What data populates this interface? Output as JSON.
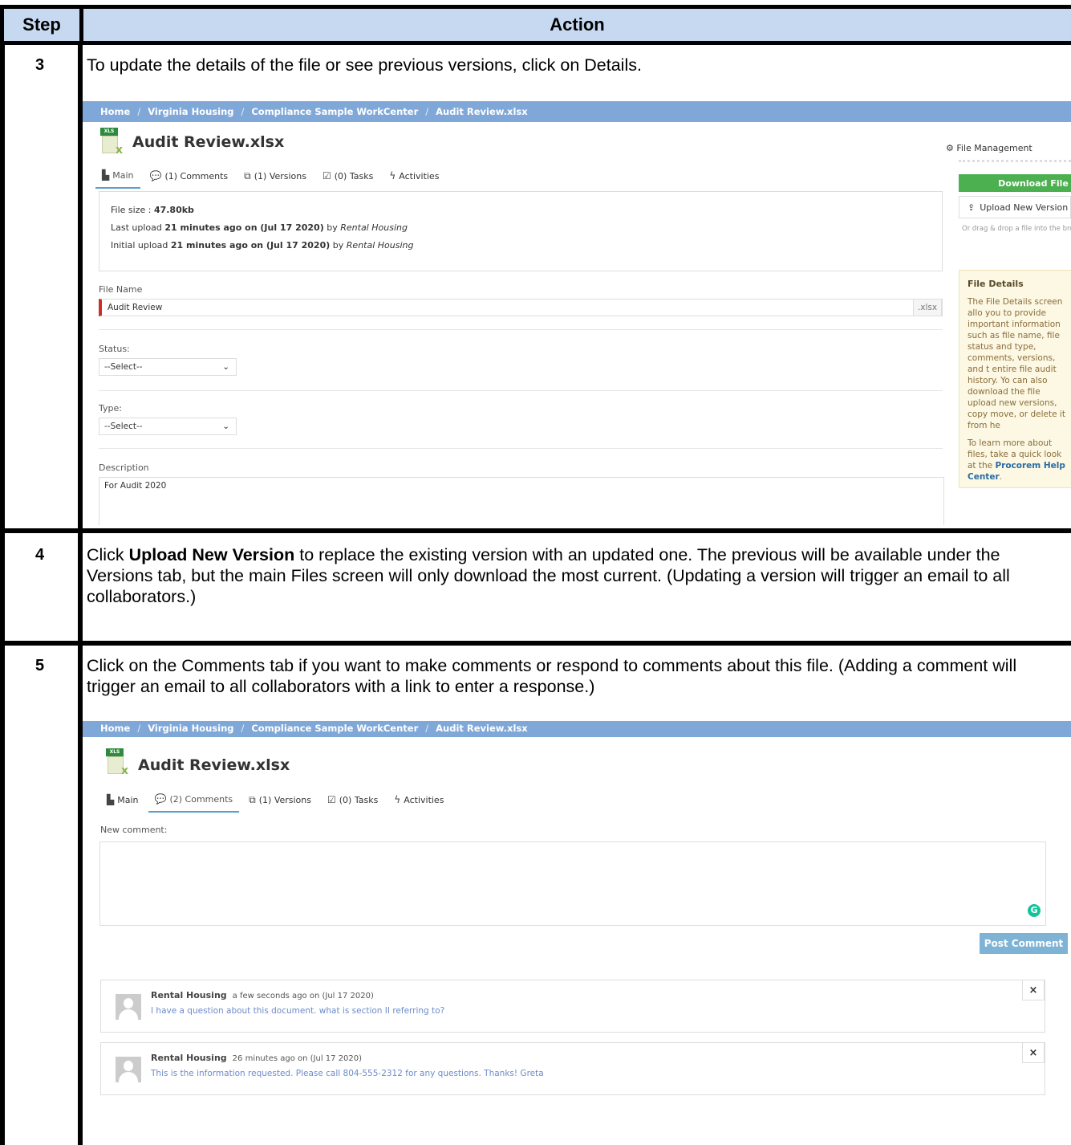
{
  "table": {
    "col_step": "Step",
    "col_action": "Action",
    "rows": [
      {
        "step": "3",
        "text": "To update the details of the file or see previous versions, click on Details."
      },
      {
        "step": "4",
        "text_before": "Click ",
        "text_bold": "Upload New Version",
        "text_after": " to replace the existing version with an updated one.  The previous will be available under the Versions tab, but the main Files screen will only download the most current. (Updating a version will trigger an email to all collaborators.)"
      },
      {
        "step": "5",
        "text": "Click on the Comments tab if you want to make comments or respond to comments about this file. (Adding a comment will trigger an email to all collaborators with a link to enter a response.)"
      }
    ]
  },
  "shot1": {
    "breadcrumb": [
      "Home",
      "Virginia Housing",
      "Compliance Sample WorkCenter",
      "Audit Review.xlsx"
    ],
    "breadcrumb_sep": "/",
    "icon_tag": "XLS",
    "title": "Audit Review.xlsx",
    "tabs": [
      "Main",
      "(1) Comments",
      "(1) Versions",
      "(0) Tasks",
      "Activities"
    ],
    "info": {
      "size_label": "File size : ",
      "size_value": "47.80kb",
      "last_prefix": "Last upload ",
      "last_bold": "21 minutes ago on (Jul 17 2020)",
      "last_by": " by ",
      "last_user": "Rental Housing",
      "init_prefix": "Initial upload ",
      "init_bold": "21 minutes ago on (Jul 17 2020)",
      "init_by": " by ",
      "init_user": "Rental Housing"
    },
    "file_name_label": "File Name",
    "file_name_value": "Audit Review",
    "file_ext": ".xlsx",
    "status_label": "Status:",
    "status_value": "--Select--",
    "type_label": "Type:",
    "type_value": "--Select--",
    "description_label": "Description",
    "description_value": "For Audit 2020",
    "side": {
      "heading": "File Management",
      "download": "Download File",
      "upload": "Upload New Version",
      "hint": "Or drag & drop a file into the brow",
      "details_title": "File Details",
      "details_p1": "The File Details screen allo you to provide important information such as file name, file status and type, comments, versions, and t entire file audit history. Yo can also download the file upload new versions, copy move, or delete it from he",
      "details_p2": "To learn more about files, take a quick look at the",
      "details_link": "Procorem Help Center",
      "details_end": "."
    }
  },
  "shot2": {
    "breadcrumb": [
      "Home",
      "Virginia Housing",
      "Compliance Sample WorkCenter",
      "Audit Review.xlsx"
    ],
    "breadcrumb_sep": "/",
    "icon_tag": "XLS",
    "title": "Audit Review.xlsx",
    "tabs": [
      "Main",
      "(2) Comments",
      "(1) Versions",
      "(0) Tasks",
      "Activities"
    ],
    "new_comment_label": "New comment:",
    "grammarly": "G",
    "post_button": "Post Comment",
    "comments": [
      {
        "author": "Rental Housing",
        "time": "a few seconds ago on (Jul 17 2020)",
        "text": "I have a question about this document. what is section II referring to?"
      },
      {
        "author": "Rental Housing",
        "time": "26 minutes ago on (Jul 17 2020)",
        "text": "This is the information requested. Please call 804-555-2312 for any questions. Thanks! Greta"
      }
    ],
    "close_glyph": "×"
  }
}
